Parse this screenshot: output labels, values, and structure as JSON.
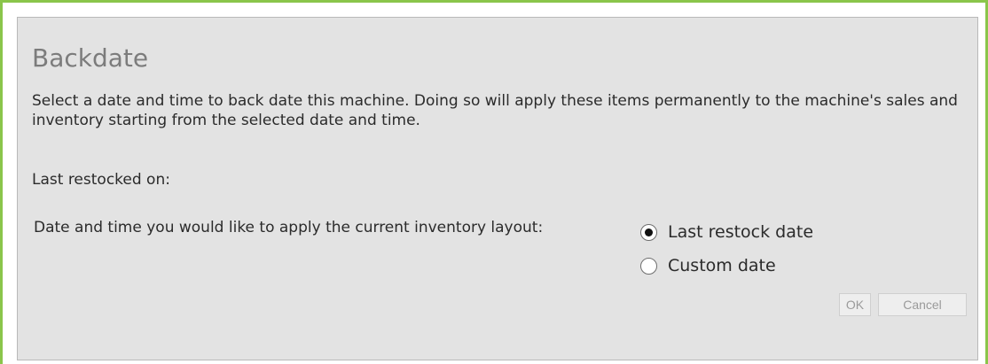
{
  "dialog": {
    "title": "Backdate",
    "description": "Select a date and time to back date this machine. Doing so will apply these items permanently to the machine's sales and inventory starting from the selected date and time.",
    "last_restocked_label": "Last restocked on:",
    "apply_label": "Date and time you would like to apply the current inventory layout:",
    "options": [
      {
        "label": "Last restock date",
        "selected": true
      },
      {
        "label": "Custom date",
        "selected": false
      }
    ],
    "ok_label": "OK",
    "cancel_label": "Cancel"
  },
  "colors": {
    "frame_border": "#8ac54b",
    "dialog_background": "#e3e3e3",
    "title_text": "#7c7c7c",
    "body_text": "#2b2b2b",
    "button_text_disabled": "#9a9a9a"
  }
}
